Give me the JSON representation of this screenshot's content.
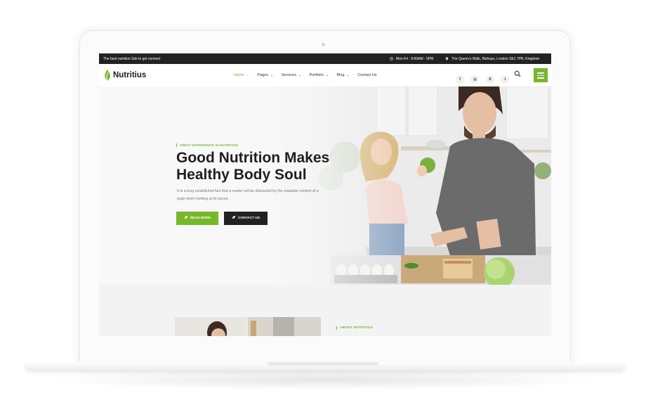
{
  "topbar": {
    "tagline": "The best nutrition Site to get connect",
    "hours": "Mon-Fri : 9:00AM - 5PM",
    "address": "The Queen's Walk, Bishops, London SE1 7PB, Kingdom"
  },
  "brand": {
    "name": "Nutritius",
    "accent": "#76b82a",
    "dark": "#222222"
  },
  "nav": {
    "items": [
      {
        "label": "Home",
        "active": true
      },
      {
        "label": "Pages"
      },
      {
        "label": "Services"
      },
      {
        "label": "Portfolio"
      },
      {
        "label": "Blog"
      },
      {
        "label": "Contact Us"
      }
    ],
    "social": [
      {
        "icon": "facebook-icon",
        "glyph": "f"
      },
      {
        "icon": "instagram-icon",
        "glyph": "◎"
      },
      {
        "icon": "skype-icon",
        "glyph": "S"
      },
      {
        "icon": "twitter-icon",
        "glyph": "t"
      }
    ]
  },
  "hero": {
    "subtitle": "GREAT EXPERIENCE IN NUTRITION",
    "title_line1": "Good Nutrition Makes",
    "title_line2": "Healthy Body Soul",
    "description": "It is a long established fact that a reader will be distracted by the readable content of a page when looking at its layout.",
    "read_more": "READ MORE",
    "contact": "CONTACT US"
  },
  "about": {
    "label": "ABOUT NUTRITIUS"
  }
}
